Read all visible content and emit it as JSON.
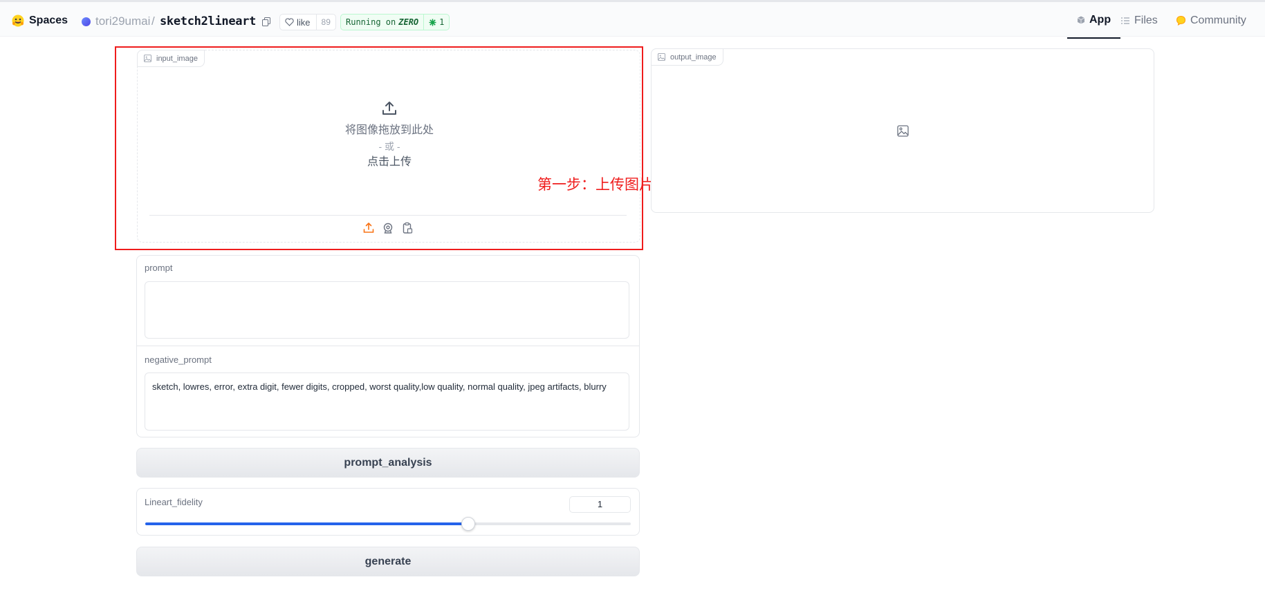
{
  "header": {
    "spaces_label": "Spaces",
    "owner": "tori29umai",
    "separator": "/",
    "repo": "sketch2lineart",
    "like_label": "like",
    "like_count": "89",
    "running_prefix": "Running on",
    "running_hardware": "ZERO",
    "zero_count": "1",
    "tabs": [
      {
        "label": "App",
        "icon": "cube-icon",
        "active": true
      },
      {
        "label": "Files",
        "icon": "files-icon",
        "active": false
      },
      {
        "label": "Community",
        "icon": "community-icon",
        "active": false
      }
    ]
  },
  "input_image": {
    "label": "input_image",
    "drop_text": "将图像拖放到此处",
    "or_text": "- 或 -",
    "click_text": "点击上传",
    "sources": [
      "upload-icon",
      "webcam-icon",
      "clipboard-icon"
    ]
  },
  "output_image": {
    "label": "output_image"
  },
  "annotation": {
    "step_note": "第一步：上传图片",
    "color": "#ef1c1c"
  },
  "prompt": {
    "label": "prompt",
    "value": ""
  },
  "negative_prompt": {
    "label": "negative_prompt",
    "value": "sketch, lowres, error, extra digit, fewer digits, cropped, worst quality,low quality, normal quality, jpeg artifacts, blurry"
  },
  "prompt_analysis_button": "prompt_analysis",
  "lineart_fidelity": {
    "label": "Lineart_fidelity",
    "value": "1",
    "fill_fraction": 0.665
  },
  "generate_button": "generate",
  "colors": {
    "accent": "#2563eb",
    "upload_icon_active": "#f97316",
    "running_badge": "#166534"
  }
}
